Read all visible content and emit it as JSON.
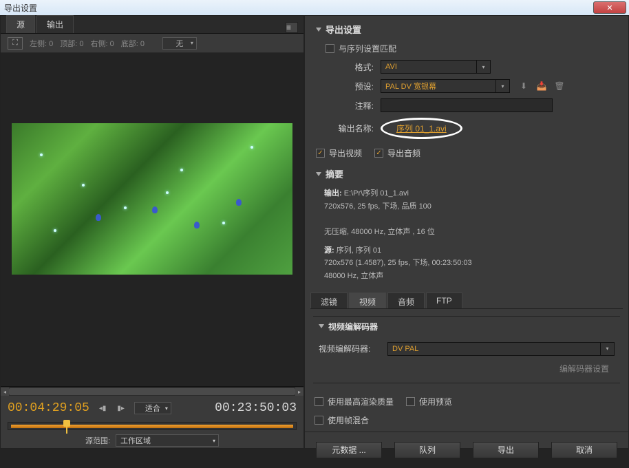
{
  "window": {
    "title": "导出设置"
  },
  "leftPanel": {
    "tabs": {
      "source": "源",
      "output": "输出"
    },
    "crop": {
      "left": "左侧: 0",
      "top": "顶部: 0",
      "right": "右侧: 0",
      "bottom": "底部: 0",
      "aspect": "无"
    },
    "timecode": {
      "current": "00:04:29:05",
      "duration": "00:23:50:03"
    },
    "fit": "适合",
    "sourceRangeLabel": "源范围:",
    "sourceRange": "工作区域"
  },
  "exportSettings": {
    "title": "导出设置",
    "matchSequence": "与序列设置匹配",
    "formatLabel": "格式:",
    "format": "AVI",
    "presetLabel": "预设:",
    "preset": "PAL DV 宽银幕",
    "commentLabel": "注释:",
    "comment": "",
    "outputNameLabel": "输出名称:",
    "outputName": "序列 01_1.avi",
    "exportVideo": "导出视频",
    "exportAudio": "导出音频"
  },
  "summary": {
    "title": "摘要",
    "outLabel": "输出:",
    "outPath": "E:\\Pr\\序列 01_1.avi",
    "outLine1": "720x576, 25 fps, 下场, 品质 100",
    "outLine2": "无压缩, 48000 Hz, 立体声 , 16 位",
    "srcLabel": "源:",
    "srcName": "序列, 序列 01",
    "srcLine1": "720x576 (1.4587), 25 fps, 下场, 00:23:50:03",
    "srcLine2": "48000 Hz, 立体声"
  },
  "innerTabs": {
    "filter": "滤镜",
    "video": "视频",
    "audio": "音频",
    "ftp": "FTP"
  },
  "codec": {
    "section": "视频编解码器",
    "label": "视频编解码器:",
    "value": "DV PAL",
    "settingsBtn": "编解码器设置"
  },
  "quality": {
    "maxRender": "使用最高渲染质量",
    "usePreview": "使用预览",
    "frameBlend": "使用帧混合"
  },
  "actions": {
    "metadata": "元数据 ...",
    "queue": "队列",
    "export": "导出",
    "cancel": "取消"
  }
}
